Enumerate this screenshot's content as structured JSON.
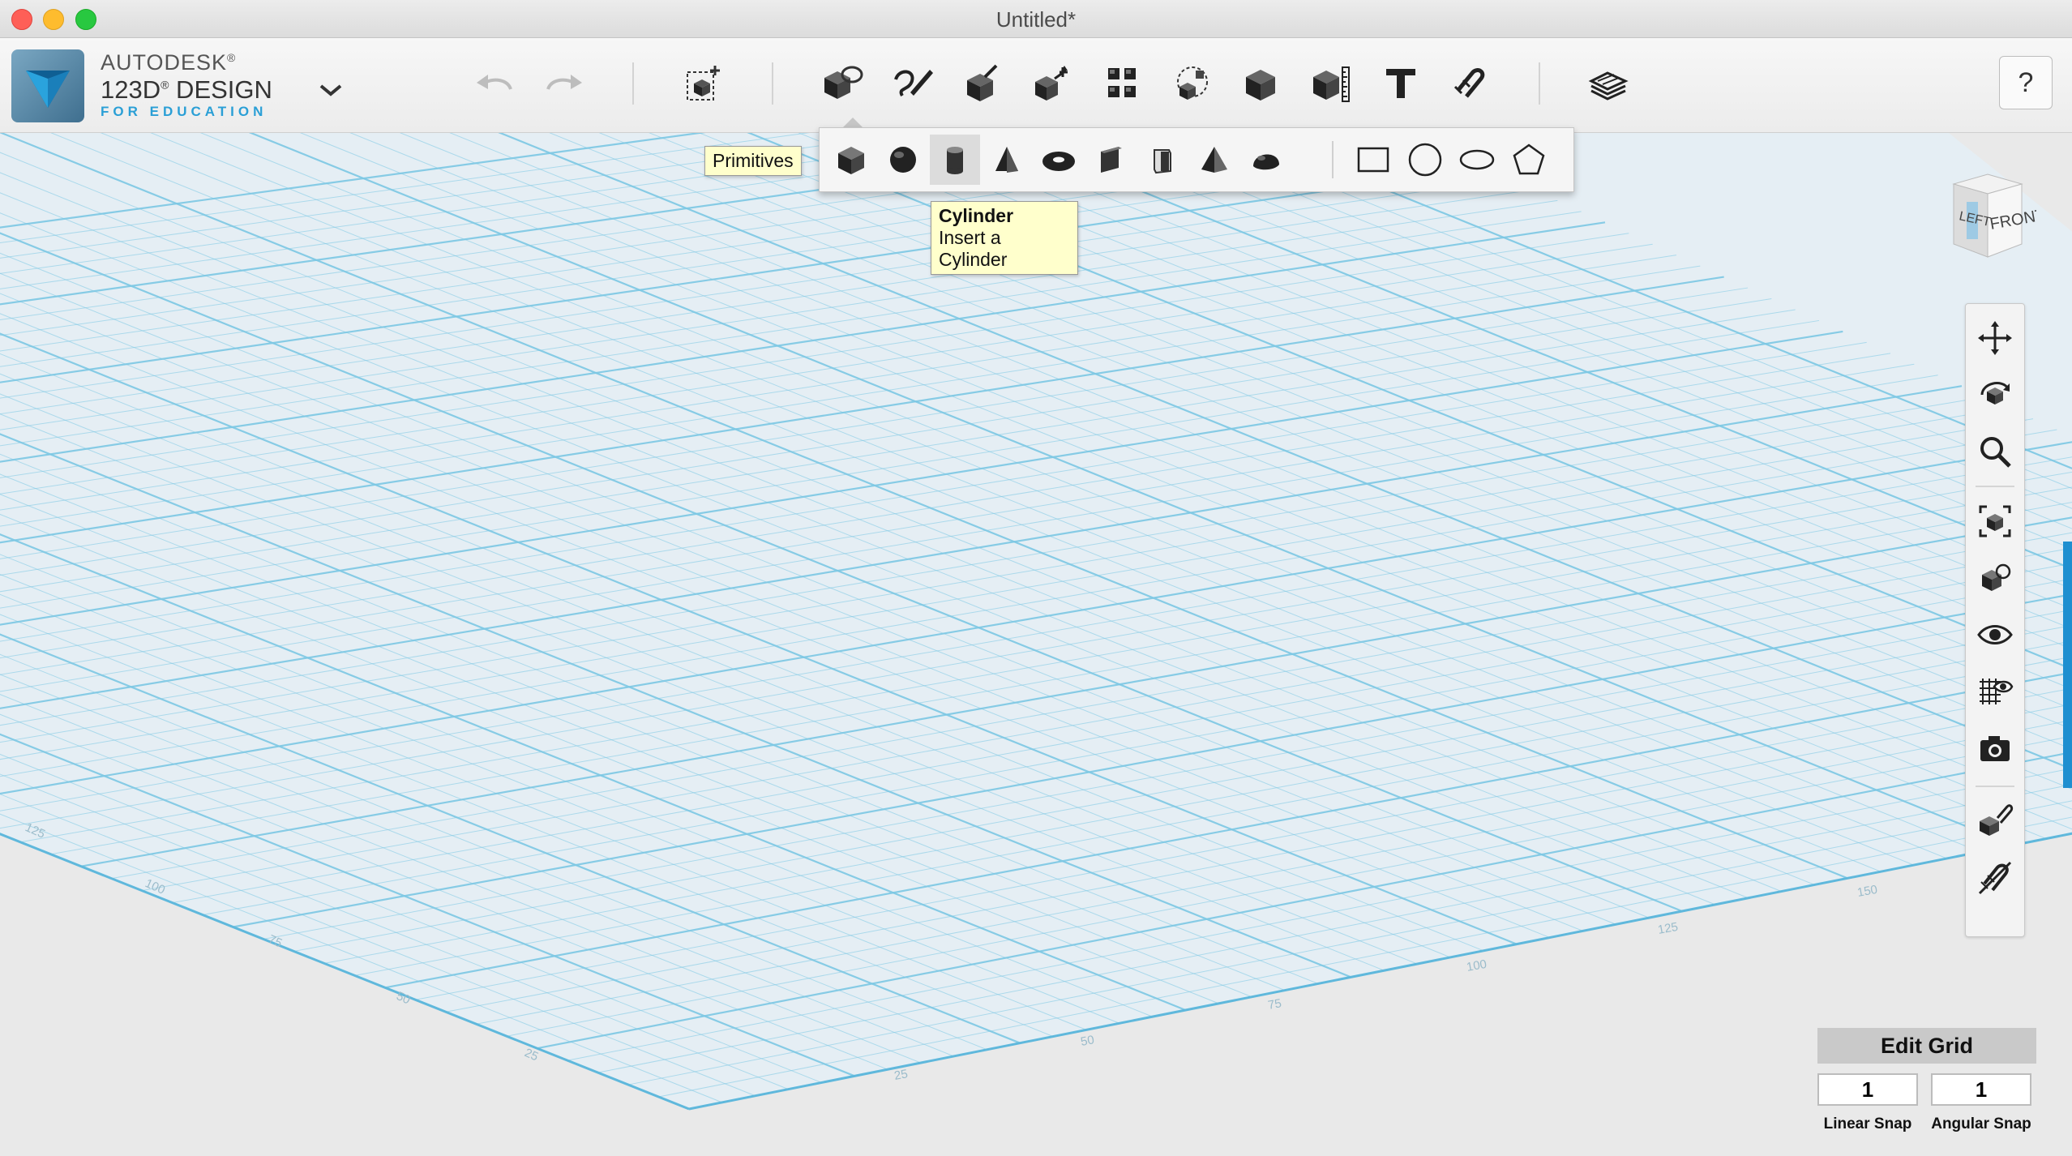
{
  "window": {
    "title": "Untitled*"
  },
  "brand": {
    "line1": "AUTODESK",
    "line1_mark": "®",
    "line2": "123D",
    "line2_mark": "®",
    "line2_rest": " DESIGN",
    "line3": "FOR EDUCATION"
  },
  "toolbar": {
    "icons": [
      "undo-icon",
      "redo-icon",
      "new-part-icon",
      "primitives-icon",
      "sketch-icon",
      "construct-icon",
      "modify-icon",
      "pattern-icon",
      "grouping-icon",
      "combine-icon",
      "measure-icon",
      "text-icon",
      "snap-icon",
      "materials-icon"
    ],
    "help_label": "?"
  },
  "primitives": {
    "tooltip": "Primitives",
    "items": [
      "box",
      "sphere",
      "cylinder",
      "cone",
      "torus",
      "wedge",
      "prism",
      "pyramid",
      "hemisphere",
      "rectangle",
      "circle",
      "ellipse",
      "polygon"
    ],
    "active": "cylinder"
  },
  "cylinder_tooltip": {
    "title": "Cylinder",
    "desc": "Insert a Cylinder"
  },
  "viewcube": {
    "left": "LEFT",
    "front": "FRONT"
  },
  "navbar": {
    "icons": [
      "pan-icon",
      "orbit-icon",
      "zoom-icon",
      "fit-icon",
      "view-perspective-icon",
      "visibility-icon",
      "grid-visibility-icon",
      "snapshot-icon",
      "material-icon",
      "hide-snap-icon"
    ]
  },
  "axis_ticks": {
    "left": [
      "125",
      "100",
      "75",
      "50",
      "25"
    ],
    "right": [
      "25",
      "50",
      "75",
      "100",
      "125",
      "150"
    ]
  },
  "edit_grid": {
    "title": "Edit Grid",
    "linear_value": "1",
    "angular_value": "1",
    "linear_label": "Linear Snap",
    "angular_label": "Angular Snap"
  },
  "colors": {
    "grid_line": "#7cc8e4",
    "grid_bg": "#e6edf2",
    "accent": "#1e8fd0",
    "tooltip_bg": "#ffffcc"
  }
}
